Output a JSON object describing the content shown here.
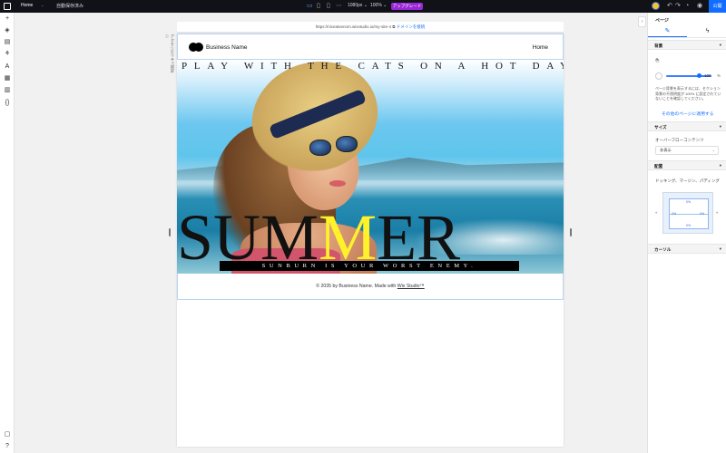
{
  "topbar": {
    "page_name": "Home",
    "page_caret": "⌄",
    "autosave": "自動保存済み",
    "width": "1080px ⌄",
    "zoom": "100% ⌄",
    "upgrade": "アップグレード",
    "publish": "公開"
  },
  "url": {
    "address": "https://niceatvenom.wixstudio.io/my-site-4",
    "connect_domain": "ドメインを接続"
  },
  "side_label": "アクセシビリティ設定 ⓘ",
  "site": {
    "business_name": "Business Name",
    "nav_home": "Home",
    "hero_title": "PLAY WITH THE CATS ON A HOT DAY",
    "summer_part1": "SUM",
    "summer_part2": "M",
    "summer_part3": "ER",
    "tagline": "SUNBURN IS YOUR WORST ENEMY.",
    "footer_text": "© 2035 by Business Name. Made with ",
    "footer_link": "Wix Studio™"
  },
  "panel": {
    "title": "ページ",
    "sections": {
      "background": "背景",
      "size": "サイズ",
      "layout": "配置",
      "cursor": "カーソル"
    },
    "color_label": "色",
    "opacity_value": "100",
    "opacity_unit": "%",
    "note": "ページ背景を表示するには、セクション背景の不透明度が 100% に設定されていないことを確認してください。",
    "apply_link": "その他のページに適用する",
    "overflow_label": "オーバーフローコンテンツ",
    "overflow_value": "非表示",
    "docking_label": "ドッキング、マージン、パディング",
    "docking_vals": [
      "0%",
      "0%",
      "0%",
      "0%"
    ]
  },
  "colors": {
    "publish": "#116dff",
    "upgrade": "#9a27d5",
    "summer_highlight": "#fff12a"
  }
}
